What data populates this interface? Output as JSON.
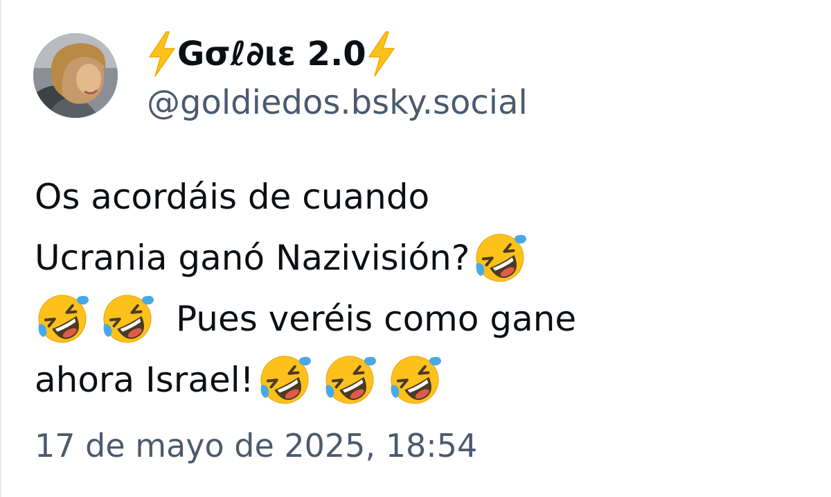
{
  "author": {
    "display_name": "Gσℓ∂ιε 2.0",
    "name_decoration_icon": "high-voltage-icon",
    "handle": "@goldiedos.bsky.social",
    "avatar_icon": "profile-avatar"
  },
  "post": {
    "lines": [
      [
        "Os acordáis de cuando"
      ],
      [
        "Ucrania ganó Nazivisión?"
      ],
      [
        "Pues veréis como gane"
      ],
      [
        "ahora Israel!"
      ]
    ],
    "emoji_icon": "rolling-on-floor-laughing-emoji",
    "timestamp": "17 de mayo de 2025, 18:54"
  },
  "colors": {
    "text": "#0b0f14",
    "secondary_text": "#4b5a6d",
    "background": "#ffffff",
    "bolt": "#fcc21b"
  }
}
